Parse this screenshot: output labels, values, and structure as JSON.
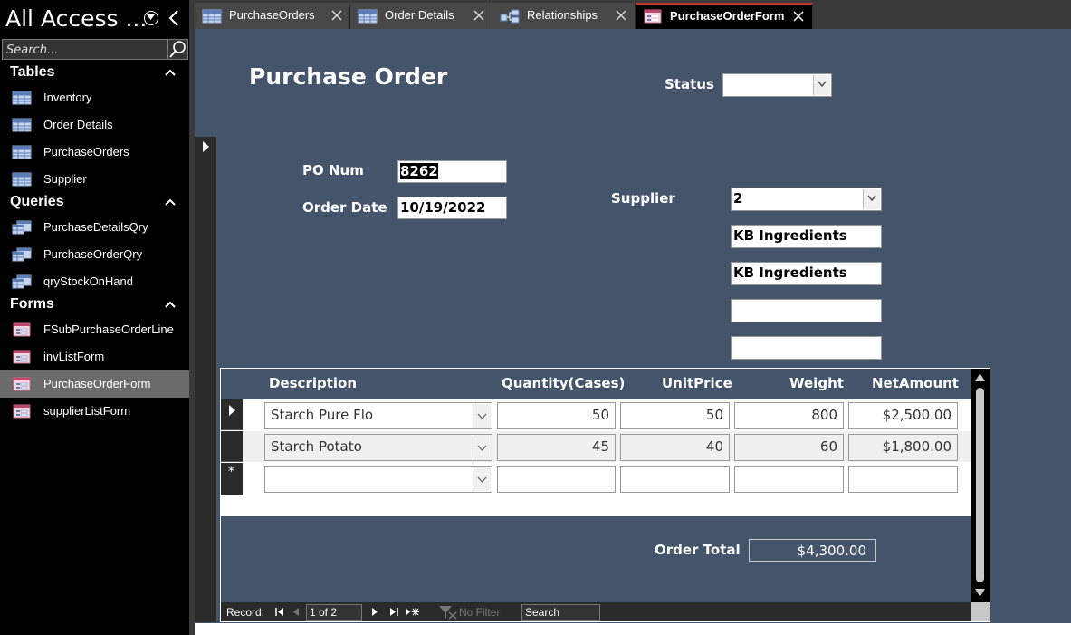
{
  "nav": {
    "title": "All Access ...",
    "search_placeholder": "Search...",
    "groups": [
      {
        "label": "Tables",
        "items": [
          "Inventory",
          "Order Details",
          "PurchaseOrders",
          "Supplier"
        ]
      },
      {
        "label": "Queries",
        "items": [
          "PurchaseDetailsQry",
          "PurchaseOrderQry",
          "qryStockOnHand"
        ]
      },
      {
        "label": "Forms",
        "items": [
          "FSubPurchaseOrderLine",
          "invListForm",
          "PurchaseOrderForm",
          "supplierListForm"
        ]
      }
    ],
    "selected_item": "PurchaseOrderForm"
  },
  "tabs": [
    {
      "label": "PurchaseOrders",
      "icon": "table-icon"
    },
    {
      "label": "Order Details",
      "icon": "table-icon"
    },
    {
      "label": "Relationships",
      "icon": "relationships-icon"
    },
    {
      "label": "PurchaseOrderForm",
      "icon": "form-icon",
      "active": true
    }
  ],
  "form": {
    "title": "Purchase Order",
    "status_label": "Status",
    "status_value": "",
    "po_num_label": "PO Num",
    "po_num": "8262",
    "order_date_label": "Order Date",
    "order_date": "10/19/2022",
    "supplier_label": "Supplier",
    "supplier_id": "2",
    "supplier_line1": "KB Ingredients",
    "supplier_line2": "KB Ingredients",
    "supplier_line3": "",
    "supplier_line4": ""
  },
  "subform": {
    "columns": [
      "Description",
      "Quantity(Cases)",
      "UnitPrice",
      "Weight",
      "NetAmount"
    ],
    "rows": [
      {
        "description": "Starch Pure Flo",
        "quantity": "50",
        "unit_price": "50",
        "weight": "800",
        "net_amount": "$2,500.00"
      },
      {
        "description": "Starch Potato",
        "quantity": "45",
        "unit_price": "40",
        "weight": "60",
        "net_amount": "$1,800.00"
      }
    ],
    "new_row_marker": "*",
    "order_total_label": "Order Total",
    "order_total": "$4,300.00"
  },
  "record_nav": {
    "record_label": "Record:",
    "position": "1 of 2",
    "filter_label": "No Filter",
    "search_label": "Search"
  }
}
